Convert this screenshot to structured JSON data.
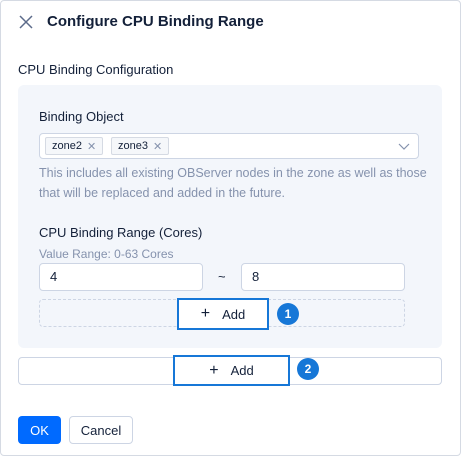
{
  "dialog": {
    "title": "Configure CPU Binding Range",
    "close_icon": "close-icon"
  },
  "section": {
    "title": "CPU Binding Configuration"
  },
  "binding": {
    "label": "Binding Object",
    "tags": [
      "zone2",
      "zone3"
    ],
    "tag_remove": "✕",
    "help_text": "This includes all existing OBServer nodes in the zone as well as those that will be replaced and added in the future."
  },
  "range": {
    "label": "CPU Binding Range (Cores)",
    "hint": "Value Range: 0-63 Cores",
    "start": "4",
    "separator": "~",
    "end": "8"
  },
  "inner_add": {
    "label": "Add",
    "badge": "1"
  },
  "outer_add": {
    "label": "Add",
    "badge": "2"
  },
  "footer": {
    "ok_label": "OK",
    "cancel_label": "Cancel"
  },
  "colors": {
    "primary": "#006aff",
    "highlight": "#1677d7",
    "panel_bg": "#f3f6fb",
    "muted_text": "#8592ad"
  }
}
